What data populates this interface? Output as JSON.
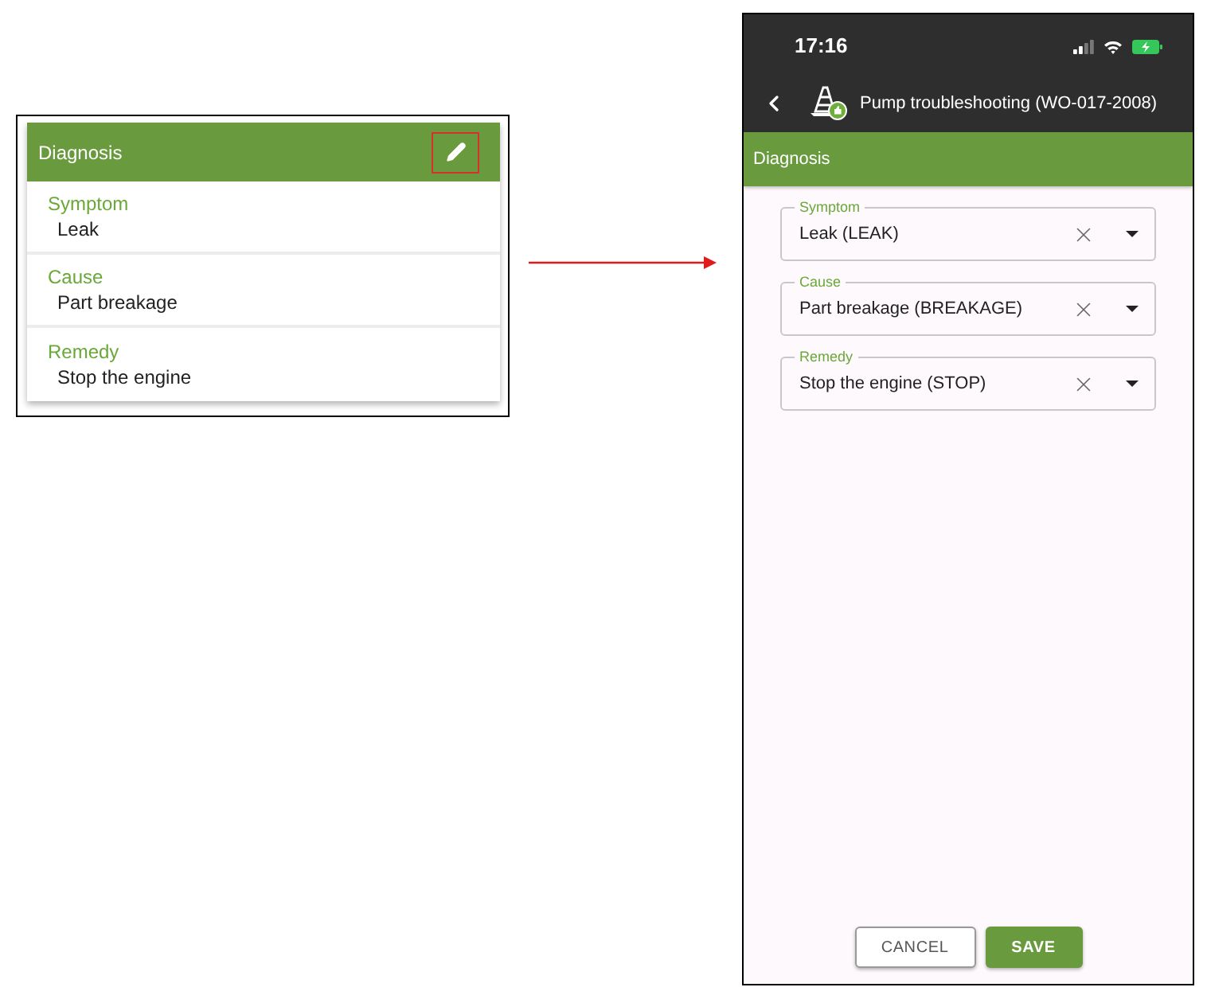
{
  "summary_card": {
    "title": "Diagnosis",
    "edit_button": {
      "highlighted": true
    },
    "rows": [
      {
        "label": "Symptom",
        "value": "Leak"
      },
      {
        "label": "Cause",
        "value": "Part breakage"
      },
      {
        "label": "Remedy",
        "value": "Stop the engine"
      }
    ]
  },
  "phone": {
    "status_bar": {
      "time": "17:16"
    },
    "nav": {
      "title": "Pump troubleshooting (WO-017-2008)"
    },
    "section": {
      "title": "Diagnosis"
    },
    "fields": [
      {
        "label": "Symptom",
        "value": "Leak (LEAK)"
      },
      {
        "label": "Cause",
        "value": "Part breakage (BREAKAGE)"
      },
      {
        "label": "Remedy",
        "value": "Stop the engine (STOP)"
      }
    ],
    "buttons": [
      {
        "label": "CANCEL",
        "kind": "outlined"
      },
      {
        "label": "SAVE",
        "kind": "filled"
      }
    ]
  }
}
